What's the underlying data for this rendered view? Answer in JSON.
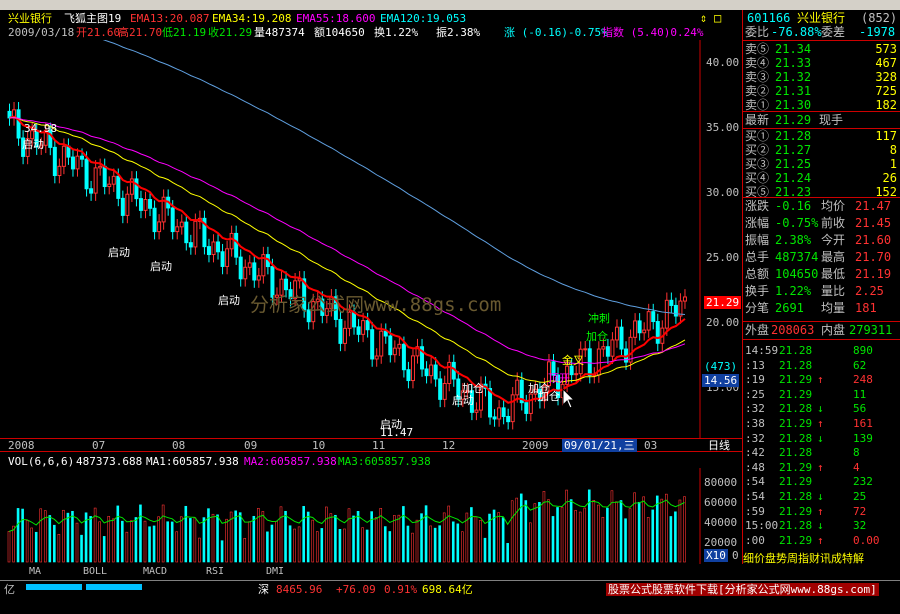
{
  "header": {
    "stock_name": "兴业银行",
    "formula": "飞狐主图19",
    "ema13": "EMA13:20.087",
    "ema34": "EMA34:19.208",
    "ema55": "EMA55:18.600",
    "ema120": "EMA120:19.053",
    "date": "2009/03/18",
    "open": "开21.60",
    "high": "高21.70",
    "low": "低21.19",
    "close": "收21.29",
    "volume": "量487374",
    "amount": "额104650",
    "turnover": "换1.22%",
    "amplitude": "振2.38%",
    "change": "涨 (-0.16)-0.75%",
    "index_label": "指数 (5.40)0.24%"
  },
  "price_axis": [
    "40.00",
    "35.00",
    "30.00",
    "25.00",
    "20.00",
    "15.00"
  ],
  "price_marks": {
    "current": "21.29",
    "high_label": "34.98",
    "low_label": "11.47",
    "count": "(473)",
    "cursor_price": "14.56"
  },
  "signals": [
    {
      "text": "启动",
      "color": "#ffffff"
    },
    {
      "text": "启动",
      "color": "#ffffff"
    },
    {
      "text": "启动",
      "color": "#ffffff"
    },
    {
      "text": "启动",
      "color": "#ffffff"
    },
    {
      "text": "启动",
      "color": "#ffffff"
    },
    {
      "text": "启动",
      "color": "#ffffff"
    },
    {
      "text": "加仓",
      "color": "#ffffff"
    },
    {
      "text": "加仓",
      "color": "#ffffff"
    },
    {
      "text": "加仓",
      "color": "#ffffff"
    },
    {
      "text": "金叉",
      "color": "#ffff00"
    },
    {
      "text": "顶开",
      "color": "#ff00ff"
    },
    {
      "text": "冲刺",
      "color": "#00ff00"
    },
    {
      "text": "加仓",
      "color": "#00ff00"
    }
  ],
  "watermark": "分析家公式网www.88gs.com",
  "time_axis": {
    "labels": [
      "2008",
      "07",
      "08",
      "09",
      "10",
      "11",
      "12",
      "2009",
      "03"
    ],
    "cursor_date": "09/01/21,三",
    "period": "日线"
  },
  "volume_header": {
    "vol": "VOL(6,6,6)",
    "vol_value": "487373.688",
    "ma1": "MA1:605857.938",
    "ma2": "MA2:605857.938",
    "ma3": "MA3:605857.938"
  },
  "volume_axis": [
    "80000",
    "60000",
    "40000",
    "20000"
  ],
  "volume_unit": "X10",
  "volume_zero": "0",
  "bottom_tabs": [
    "MA",
    "BOLL",
    "MACD",
    "RSI",
    "DMI"
  ],
  "right_panel": {
    "code": "601166",
    "name": "兴业银行",
    "count": "(852)",
    "weibi_label": "委比",
    "weibi_value": "-76.88%",
    "weicha_label": "委差",
    "weicha_value": "-1978",
    "sells": [
      {
        "label": "卖⑤",
        "price": "21.34",
        "vol": "573"
      },
      {
        "label": "卖④",
        "price": "21.33",
        "vol": "467"
      },
      {
        "label": "卖③",
        "price": "21.32",
        "vol": "328"
      },
      {
        "label": "卖②",
        "price": "21.31",
        "vol": "725"
      },
      {
        "label": "卖①",
        "price": "21.30",
        "vol": "182"
      }
    ],
    "latest_label": "最新",
    "latest_value": "21.29",
    "latest_hand": "现手",
    "buys": [
      {
        "label": "买①",
        "price": "21.28",
        "vol": "117"
      },
      {
        "label": "买②",
        "price": "21.27",
        "vol": "8"
      },
      {
        "label": "买③",
        "price": "21.25",
        "vol": "1"
      },
      {
        "label": "买④",
        "price": "21.24",
        "vol": "26"
      },
      {
        "label": "买⑤",
        "price": "21.23",
        "vol": "152"
      }
    ],
    "stats": [
      {
        "l1": "涨跌",
        "v1": "-0.16",
        "l2": "均价",
        "v2": "21.47"
      },
      {
        "l1": "涨幅",
        "v1": "-0.75%",
        "l2": "前收",
        "v2": "21.45"
      },
      {
        "l1": "振幅",
        "v1": "2.38%",
        "l2": "今开",
        "v2": "21.60"
      },
      {
        "l1": "总手",
        "v1": "487374",
        "l2": "最高",
        "v2": "21.70"
      },
      {
        "l1": "总额",
        "v1": "104650",
        "l2": "最低",
        "v2": "21.19"
      },
      {
        "l1": "换手",
        "v1": "1.22%",
        "l2": "量比",
        "v2": "2.25"
      },
      {
        "l1": "分笔",
        "v1": "2691",
        "l2": "均量",
        "v2": "181"
      }
    ],
    "outer_label": "外盘",
    "outer_value": "208063",
    "inner_label": "内盘",
    "inner_value": "279311",
    "minutes": [
      {
        "time": "14:59",
        "price": "21.28",
        "arrow": "",
        "vol": "890"
      },
      {
        "time": ":13",
        "price": "21.28",
        "arrow": "",
        "vol": "62"
      },
      {
        "time": ":19",
        "price": "21.29",
        "arrow": "↑",
        "vol": "248"
      },
      {
        "time": ":25",
        "price": "21.29",
        "arrow": "",
        "vol": "11"
      },
      {
        "time": ":32",
        "price": "21.28",
        "arrow": "↓",
        "vol": "56"
      },
      {
        "time": ":38",
        "price": "21.29",
        "arrow": "↑",
        "vol": "161"
      },
      {
        "time": ":32",
        "price": "21.28",
        "arrow": "↓",
        "vol": "139"
      },
      {
        "time": ":42",
        "price": "21.28",
        "arrow": "",
        "vol": "8"
      },
      {
        "time": ":48",
        "price": "21.29",
        "arrow": "↑",
        "vol": "4"
      },
      {
        "time": ":54",
        "price": "21.29",
        "arrow": "",
        "vol": "232"
      },
      {
        "time": ":54",
        "price": "21.28",
        "arrow": "↓",
        "vol": "25"
      },
      {
        "time": ":59",
        "price": "21.29",
        "arrow": "↑",
        "vol": "72"
      },
      {
        "time": "15:00",
        "price": "21.28",
        "arrow": "↓",
        "vol": "32"
      },
      {
        "time": ":00",
        "price": "21.29",
        "arrow": "↑",
        "vol": "0.00"
      }
    ],
    "footer_text": "细价盘势周指财讯成特解"
  },
  "status_bar": {
    "market": "深",
    "index_value": "8465.96",
    "index_change": "+76.09",
    "index_pct": "0.91%",
    "index_amount": "698.64亿",
    "left_amount": "亿",
    "ad_text": "股票公式股票软件下载[分析家公式网www.88gs.com]"
  },
  "colors": {
    "up": "#ff3232",
    "down": "#00ffff",
    "ema13": "#ff0000",
    "ema34": "#ffff00",
    "ema55": "#ff00ff",
    "ema120": "#5f9fdf",
    "volume_ma": "#00e600"
  }
}
